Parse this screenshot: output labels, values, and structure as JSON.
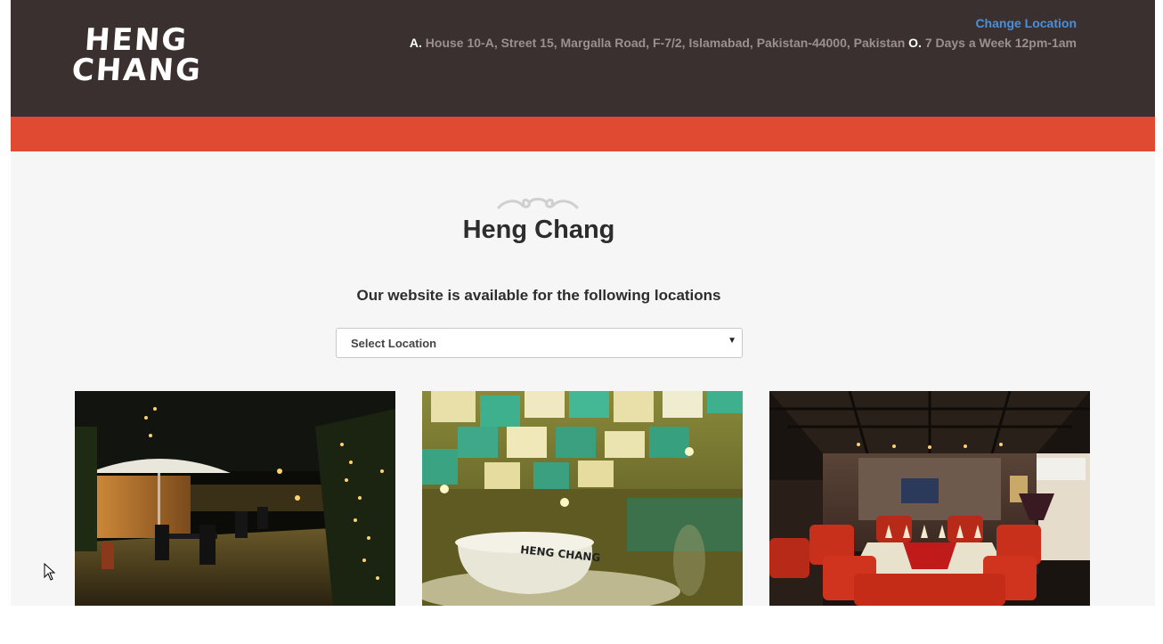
{
  "header": {
    "logo_line1": "HENG",
    "logo_line2": "CHANG",
    "change_location": "Change Location",
    "address_label": "A.",
    "address": "House 10-A, Street 15, Margalla Road, F-7/2, Islamabad, Pakistan-44000, Pakistan",
    "hours_label": "O.",
    "hours": "7 Days a Week 12pm-1am"
  },
  "main": {
    "title": "Heng Chang",
    "subtitle": "Our website is available for the following locations",
    "location_select": {
      "selected": "Select Location"
    }
  },
  "gallery": {
    "cup_text": "HENG CHANG"
  },
  "colors": {
    "header_bg": "#3a3030",
    "accent_red": "#e04a33",
    "link_blue": "#4a90d9",
    "page_bg": "#f6f6f6"
  }
}
